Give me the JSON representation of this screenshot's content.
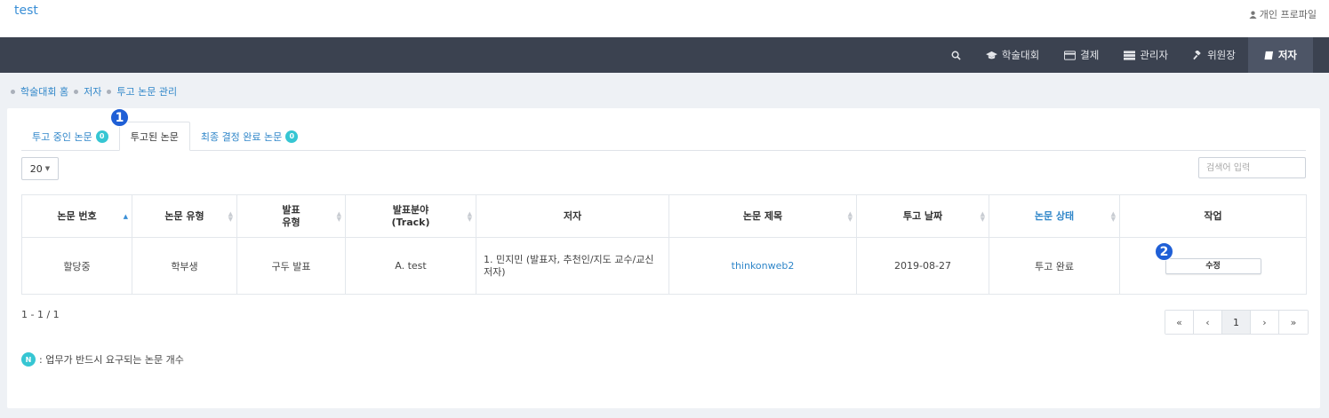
{
  "header": {
    "brand": "test",
    "profile_label": "개인 프로파일"
  },
  "nav": {
    "items": [
      {
        "label": "",
        "icon": "search-icon"
      },
      {
        "label": "학술대회",
        "icon": "graduation-cap-icon"
      },
      {
        "label": "결제",
        "icon": "credit-card-icon"
      },
      {
        "label": "관리자",
        "icon": "list-icon"
      },
      {
        "label": "위원장",
        "icon": "gavel-icon"
      },
      {
        "label": "저자",
        "icon": "book-icon",
        "active": true
      }
    ]
  },
  "breadcrumb": [
    "학술대회 홈",
    "저자",
    "투고 논문 관리"
  ],
  "tabs": [
    {
      "label": "투고 중인 논문",
      "badge": "0"
    },
    {
      "label": "투고된 논문"
    },
    {
      "label": "최종 결정 완료 논문",
      "badge": "0"
    }
  ],
  "markers": [
    "1",
    "2"
  ],
  "controls": {
    "page_size": "20",
    "search_placeholder": "검색어 입력"
  },
  "table": {
    "headers": [
      "논문 번호",
      "논문 유형",
      "발표\n유형",
      "발표분야\n(Track)",
      "저자",
      "논문 제목",
      "투고 날짜",
      "논문 상태",
      "작업"
    ],
    "rows": [
      {
        "number": "할당중",
        "type": "학부생",
        "presentation": "구두 발표",
        "track": "A. test",
        "author": "1. 민지민 (발표자, 추천인/지도 교수/교신저자)",
        "title": "thinkonweb2",
        "date": "2019-08-27",
        "status": "투고 완료",
        "action": "수정"
      }
    ]
  },
  "pagination": {
    "summary": "1 - 1 / 1",
    "first": "«",
    "prev": "‹",
    "current": "1",
    "next": "›",
    "last": "»"
  },
  "legend": {
    "badge": "N",
    "text": ": 업무가 반드시 요구되는 논문 개수"
  },
  "colors": {
    "accent": "#2f86c9",
    "navbar": "#3b4250",
    "badge": "#36c6d3",
    "marker": "#1f5fd6"
  }
}
